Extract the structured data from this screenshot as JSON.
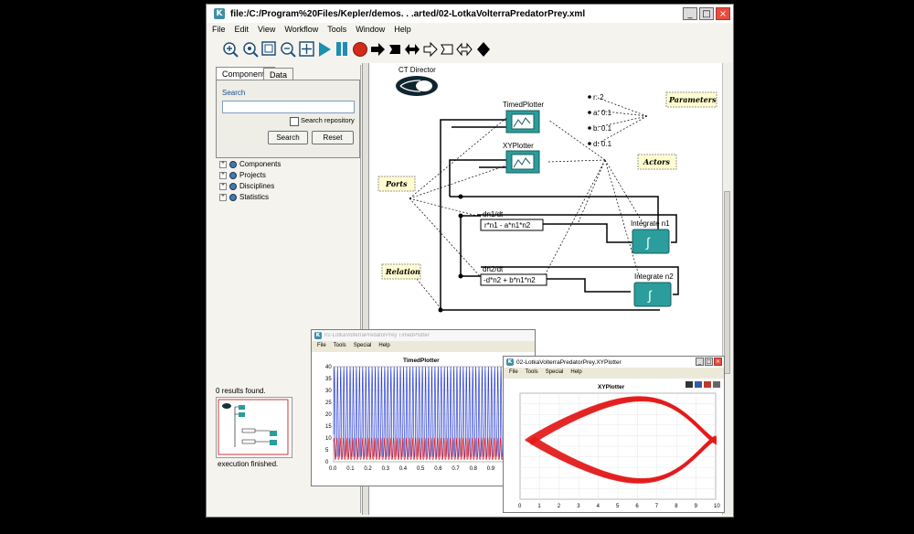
{
  "main_window": {
    "title": "file:/C:/Program%20Files/Kepler/demos. . .arted/02-LotkaVolterraPredatorPrey.xml",
    "menu": [
      "File",
      "Edit",
      "View",
      "Workflow",
      "Tools",
      "Window",
      "Help"
    ],
    "tabs": [
      "Components",
      "Data"
    ],
    "search_label": "Search",
    "search_value": "",
    "search_repository_label": "Search repository",
    "search_button": "Search",
    "reset_button": "Reset",
    "tree": [
      "Components",
      "Projects",
      "Disciplines",
      "Statistics"
    ],
    "results_text": "0 results found.",
    "status_text": "execution finished."
  },
  "workflow": {
    "director": "CT Director",
    "actors": {
      "timed_plotter": "TimedPlotter",
      "xy_plotter": "XYPlotter",
      "dn1": "dn1/dt",
      "dn1_expr": "r*n1 - a*n1*n2",
      "dn2": "dn2/dt",
      "dn2_expr": "-d*n2 + b*n1*n2",
      "integrate1": "Integrate n1",
      "integrate2": "Integrate n2"
    },
    "parameters": [
      "r: 2",
      "a: 0.1",
      "b: 0.1",
      "d: 0.1"
    ],
    "annotations": {
      "parameters": "Parameters",
      "actors": "Actors",
      "ports": "Ports",
      "relation": "Relation"
    }
  },
  "timed_window": {
    "title": "02-LotkaVolterraPredatorPrey TimedPlotter",
    "menu": [
      "File",
      "Tools",
      "Special",
      "Help"
    ],
    "plot_title": "TimedPlotter"
  },
  "xy_window": {
    "title": "02-LotkaVolterraPredatorPrey.XYPlotter",
    "menu": [
      "File",
      "Tools",
      "Special",
      "Help"
    ],
    "plot_title": "XYPlotter"
  },
  "chart_data": [
    {
      "type": "line",
      "title": "TimedPlotter",
      "xlim": [
        0,
        1.0
      ],
      "ylim": [
        0,
        40
      ],
      "x_ticks": [
        "0.0",
        "0.1",
        "0.2",
        "0.3",
        "0.4",
        "0.5",
        "0.6",
        "0.7",
        "0.8",
        "0.9"
      ],
      "y_ticks": [
        "0",
        "5",
        "10",
        "15",
        "20",
        "25",
        "30",
        "35",
        "40"
      ],
      "series": [
        {
          "color": "#2b3fd6",
          "min": 2,
          "max": 40,
          "cycles": 55
        },
        {
          "color": "#e02020",
          "min": 1,
          "max": 10,
          "cycles": 55
        }
      ]
    },
    {
      "type": "line",
      "title": "XYPlotter",
      "xlim": [
        0,
        10
      ],
      "ylim": [
        0,
        10
      ],
      "x_ticks": [
        "0",
        "1",
        "2",
        "3",
        "4",
        "5",
        "6",
        "7",
        "8",
        "9",
        "10"
      ],
      "series": [
        {
          "color": "#e31b1b",
          "x_range": [
            0.3,
            10
          ],
          "y_range": [
            1.2,
            10
          ]
        }
      ]
    }
  ]
}
